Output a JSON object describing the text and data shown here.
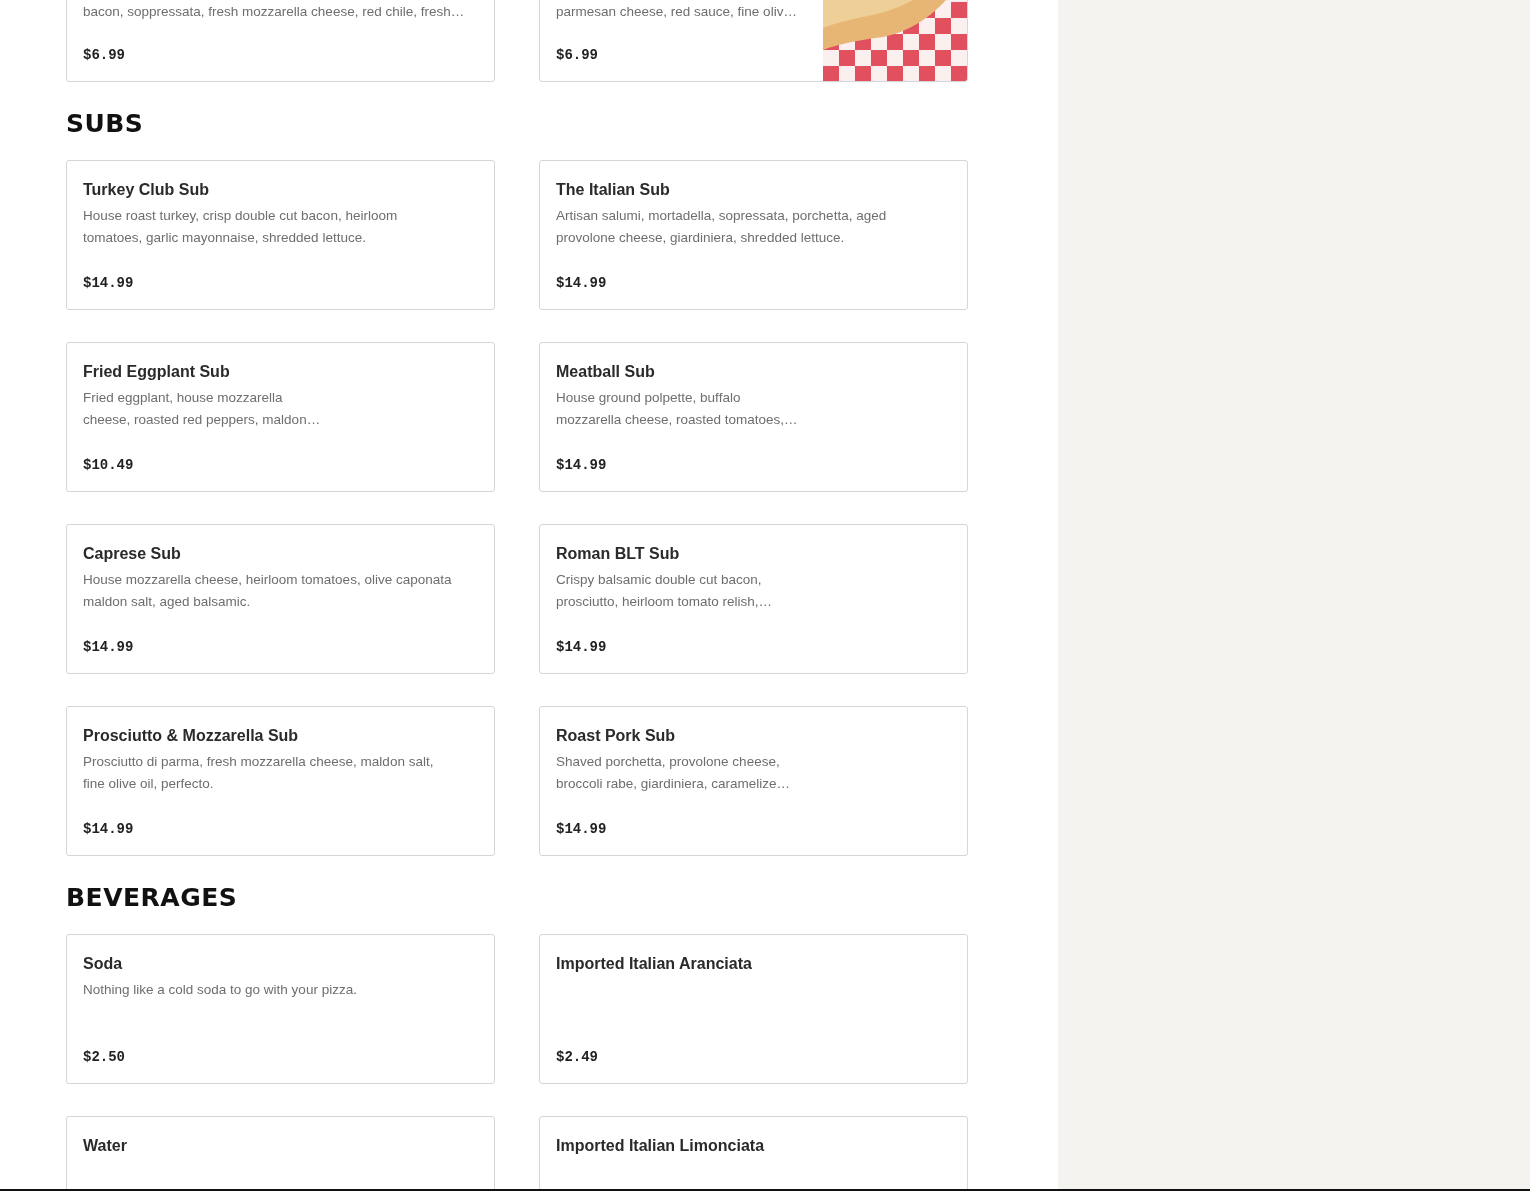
{
  "sections": [
    {
      "items": [
        {
          "description": [
            "bacon, soppressata, fresh mozzarella cheese, red chile, fresh…"
          ],
          "price": "$6.99"
        },
        {
          "description": [
            "parmesan cheese, red sauce, fine oliv…"
          ],
          "price": "$6.99",
          "image": {
            "kind": "picture"
          }
        }
      ]
    },
    {
      "heading": "SUBS",
      "items": [
        {
          "name": "Turkey Club Sub",
          "description": [
            "House roast turkey, crisp double cut bacon, heirloom",
            "tomatoes, garlic mayonnaise, shredded lettuce."
          ],
          "price": "$14.99"
        },
        {
          "name": "The Italian Sub",
          "description": [
            "Artisan salumi, mortadella, sopressata, porchetta, aged",
            "provolone cheese, giardiniera, shredded lettuce."
          ],
          "price": "$14.99"
        },
        {
          "name": "Fried Eggplant Sub",
          "description": [
            "Fried eggplant, house mozzarella",
            "cheese, roasted red peppers, maldon…"
          ],
          "price": "$10.49"
        },
        {
          "name": "Meatball Sub",
          "description": [
            "House ground polpette, buffalo",
            "mozzarella cheese, roasted tomatoes,…"
          ],
          "price": "$14.99"
        },
        {
          "name": "Caprese Sub",
          "description": [
            "House mozzarella cheese, heirloom tomatoes, olive caponata",
            "maldon salt, aged balsamic."
          ],
          "price": "$14.99"
        },
        {
          "name": "Roman BLT Sub",
          "description": [
            "Crispy balsamic double cut bacon,",
            "prosciutto, heirloom tomato relish,…"
          ],
          "price": "$14.99"
        },
        {
          "name": "Prosciutto & Mozzarella Sub",
          "description": [
            "Prosciutto di parma, fresh mozzarella cheese, maldon salt,",
            "fine olive oil, perfecto."
          ],
          "price": "$14.99"
        },
        {
          "name": "Roast Pork Sub",
          "description": [
            "Shaved porchetta, provolone cheese,",
            "broccoli rabe, giardiniera, caramelize…"
          ],
          "price": "$14.99"
        }
      ]
    },
    {
      "heading": "BEVERAGES",
      "items": [
        {
          "name": "Soda",
          "description": [
            "Nothing like a cold soda to go with your pizza."
          ],
          "price": "$2.50"
        },
        {
          "name": "Imported Italian Aranciata",
          "price": "$2.49"
        },
        {
          "name": "Water"
        },
        {
          "name": "Imported Italian Limonciata"
        }
      ]
    }
  ]
}
